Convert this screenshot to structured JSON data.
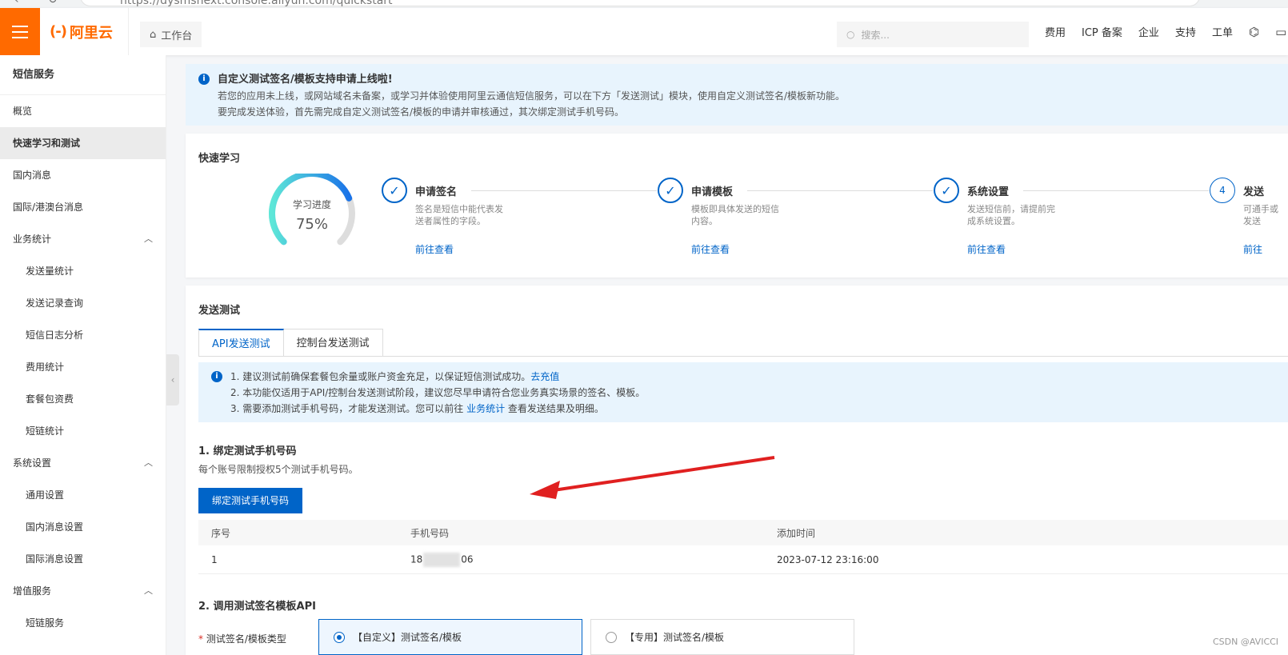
{
  "browser": {
    "url": "https://dysmsnext.console.aliyun.com/quickstart"
  },
  "header": {
    "logo_text": "阿里云",
    "workbench": "工作台",
    "search_placeholder": "搜索...",
    "nav": [
      "费用",
      "ICP 备案",
      "企业",
      "支持",
      "工单"
    ]
  },
  "sidebar": {
    "title": "短信服务",
    "items": [
      {
        "label": "概览"
      },
      {
        "label": "快速学习和测试"
      },
      {
        "label": "国内消息"
      },
      {
        "label": "国际/港澳台消息"
      },
      {
        "label": "业务统计"
      },
      {
        "label": "发送量统计"
      },
      {
        "label": "发送记录查询"
      },
      {
        "label": "短信日志分析"
      },
      {
        "label": "费用统计"
      },
      {
        "label": "套餐包资费"
      },
      {
        "label": "短链统计"
      },
      {
        "label": "系统设置"
      },
      {
        "label": "通用设置"
      },
      {
        "label": "国内消息设置"
      },
      {
        "label": "国际消息设置"
      },
      {
        "label": "增值服务"
      },
      {
        "label": "短链服务"
      }
    ]
  },
  "notice": {
    "title": "自定义测试签名/模板支持申请上线啦!",
    "line1": "若您的应用未上线，或网站域名未备案，或学习并体验使用阿里云通信短信服务，可以在下方「发送测试」模块，使用自定义测试签名/模板新功能。",
    "line2": "要完成发送体验，首先需完成自定义测试签名/模板的申请并审核通过，其次绑定测试手机号码。"
  },
  "quick_learn": {
    "title": "快速学习",
    "progress_label": "学习进度",
    "progress_value": "75%",
    "progress": 0.75,
    "steps": [
      {
        "name": "申请签名",
        "desc": "签名是短信中能代表发送者属性的字段。",
        "link": "前往查看"
      },
      {
        "name": "申请模板",
        "desc": "模板即具体发送的短信内容。",
        "link": "前往查看"
      },
      {
        "name": "系统设置",
        "desc": "发送短信前，请提前完成系统设置。",
        "link": "前往查看"
      },
      {
        "name": "发送",
        "number": "4",
        "desc": "可通手或发送",
        "link": "前往"
      }
    ]
  },
  "send_test": {
    "title": "发送测试",
    "tabs": [
      "API发送测试",
      "控制台发送测试"
    ],
    "info": {
      "line1": "1. 建议测试前确保套餐包余量或账户资金充足，以保证短信测试成功。",
      "line1_link": "去充值",
      "line2": "2. 本功能仅适用于API/控制台发送测试阶段，建议您尽早申请符合您业务真实场景的签名、模板。",
      "line3_pre": "3. 需要添加测试手机号码，才能发送测试。您可以前往 ",
      "line3_link": "业务统计",
      "line3_post": " 查看发送结果及明细。"
    },
    "bind": {
      "title": "1. 绑定测试手机号码",
      "subtitle": "每个账号限制授权5个测试手机号码。",
      "button": "绑定测试手机号码",
      "table": {
        "headers": [
          "序号",
          "手机号码",
          "添加时间"
        ],
        "rows": [
          {
            "index": "1",
            "phone_prefix": "18",
            "phone_suffix": "06",
            "time": "2023-07-12 23:16:00"
          }
        ]
      }
    },
    "api": {
      "title": "2. 调用测试签名模板API",
      "field_required": "*",
      "field_label": "测试签名/模板类型",
      "options": [
        "【自定义】测试签名/模板",
        "【专用】测试签名/模板"
      ]
    }
  },
  "watermark": "CSDN @AVICCI"
}
